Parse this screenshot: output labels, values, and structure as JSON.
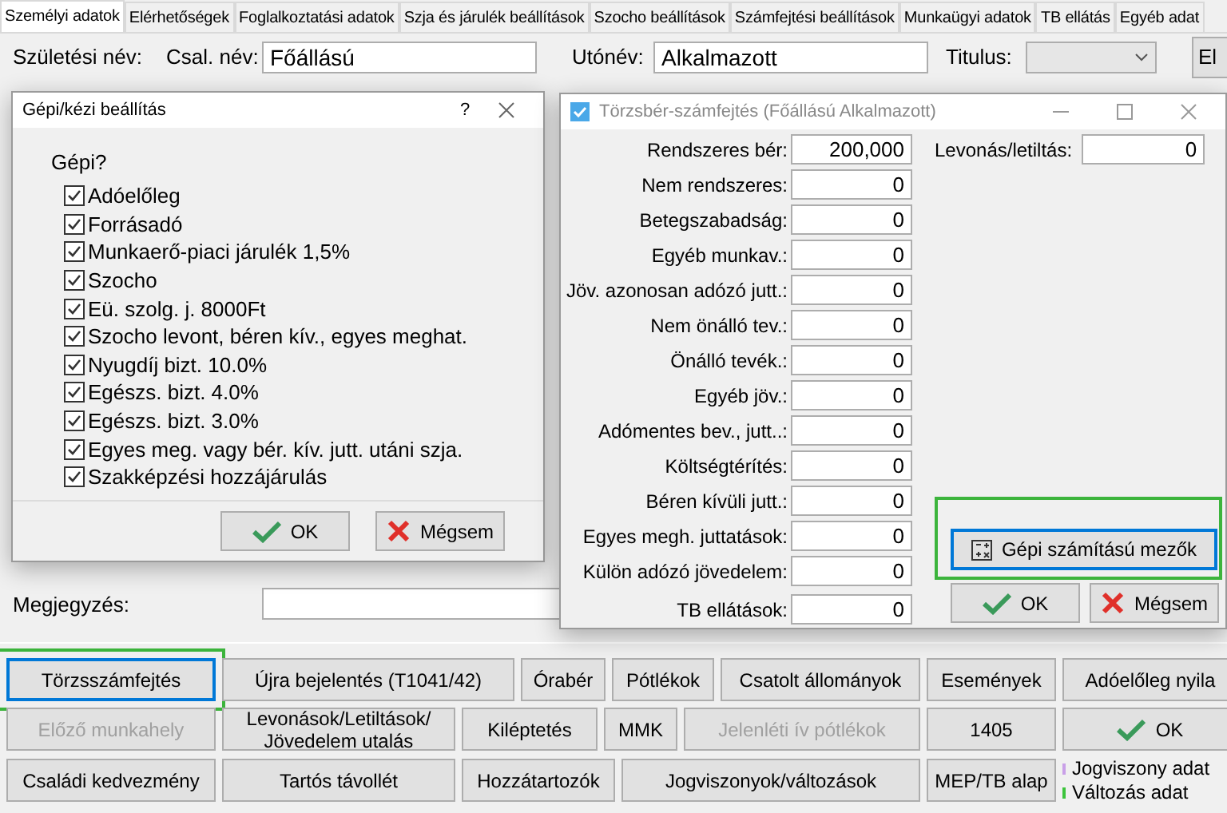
{
  "tabs": [
    {
      "label": "Személyi adatok",
      "selected": true
    },
    {
      "label": "Elérhetőségek",
      "selected": false
    },
    {
      "label": "Foglalkoztatási adatok",
      "selected": false
    },
    {
      "label": "Szja és járulék beállítások",
      "selected": false
    },
    {
      "label": "Szocho beállítások",
      "selected": false
    },
    {
      "label": "Számfejtési beállítások",
      "selected": false
    },
    {
      "label": "Munkaügyi adatok",
      "selected": false
    },
    {
      "label": "TB ellátás",
      "selected": false
    },
    {
      "label": "Egyéb adat",
      "selected": false
    }
  ],
  "form_rows": [
    {
      "label": "Születési név:",
      "family_label": "Csal. név:",
      "family_value": "Főállású",
      "given_label": "Utónév:",
      "given_value": "Alkalmazott",
      "extra_label": "Titulus:",
      "side_button": "El"
    }
  ],
  "note_label": "Megjegyzés:",
  "settings_dialog": {
    "title": "Gépi/kézi beállítás",
    "help": "?",
    "heading": "Gépi?",
    "options": [
      {
        "label": "Adóelőleg",
        "checked": true
      },
      {
        "label": "Forrásadó",
        "checked": true
      },
      {
        "label": "Munkaerő-piaci járulék 1,5%",
        "checked": true
      },
      {
        "label": "Szocho",
        "checked": true
      },
      {
        "label": "Eü. szolg. j. 8000Ft",
        "checked": true
      },
      {
        "label": "Szocho levont, béren kív., egyes meghat.",
        "checked": true
      },
      {
        "label": "Nyugdíj bizt. 10.0%",
        "checked": true
      },
      {
        "label": "Egészs. bizt. 4.0%",
        "checked": true
      },
      {
        "label": "Egészs. bizt. 3.0%",
        "checked": true
      },
      {
        "label": "Egyes meg. vagy bér. kív. jutt. utáni szja.",
        "checked": true
      },
      {
        "label": "Szakképzési hozzájárulás",
        "checked": true
      }
    ],
    "ok": "OK",
    "cancel": "Mégsem"
  },
  "salary_dialog": {
    "title": "Törzsbér-számfejtés (Főállású Alkalmazott)",
    "fields": [
      {
        "label": "Rendszeres bér:",
        "value": "200,000"
      },
      {
        "label": "Nem rendszeres:",
        "value": "0"
      },
      {
        "label": "Betegszabadság:",
        "value": "0"
      },
      {
        "label": "Egyéb munkav.:",
        "value": "0"
      },
      {
        "label": "Jöv. azonosan adózó jutt.:",
        "value": "0"
      },
      {
        "label": "Nem önálló tev.:",
        "value": "0"
      },
      {
        "label": "Önálló tevék.:",
        "value": "0"
      },
      {
        "label": "Egyéb jöv.:",
        "value": "0"
      },
      {
        "label": "Adómentes bev., jutt..:",
        "value": "0"
      },
      {
        "label": "Költségtérítés:",
        "value": "0"
      },
      {
        "label": "Béren kívüli jutt.:",
        "value": "0"
      },
      {
        "label": "Egyes megh. juttatások:",
        "value": "0"
      },
      {
        "label": "Külön adózó jövedelem:",
        "value": "0"
      },
      {
        "label": "TB ellátások:",
        "value": "0"
      }
    ],
    "deduction": {
      "label": "Levonás/letiltás:",
      "value": "0"
    },
    "calc_button": {
      "label": "Gépi számítású mezők",
      "focused": true,
      "highlighted": true
    },
    "ok": "OK",
    "cancel": "Mégsem"
  },
  "bottom_rows": [
    [
      {
        "label": "Törzsszámfejtés",
        "disabled": false,
        "focused": true,
        "highlighted": true
      },
      {
        "label": "Újra bejelentés (T1041/42)",
        "disabled": false,
        "focused": false,
        "highlighted": false
      },
      {
        "label": "Órabér",
        "disabled": false,
        "focused": false,
        "highlighted": false
      },
      {
        "label": "Pótlékok",
        "disabled": false,
        "focused": false,
        "highlighted": false
      },
      {
        "label": "Csatolt állományok",
        "disabled": false,
        "focused": false,
        "highlighted": false
      },
      {
        "label": "Események",
        "disabled": false,
        "focused": false,
        "highlighted": false
      },
      {
        "label": "Adóelőleg nyila",
        "disabled": false,
        "focused": false,
        "highlighted": false
      }
    ],
    [
      {
        "label": "Előző munkahely",
        "disabled": true,
        "focused": false,
        "highlighted": false
      },
      {
        "label": "Levonások/Letiltások/ Jövedelem utalás",
        "disabled": false,
        "focused": false,
        "highlighted": false
      },
      {
        "label": "Kiléptetés",
        "disabled": false,
        "focused": false,
        "highlighted": false
      },
      {
        "label": "MMK",
        "disabled": false,
        "focused": false,
        "highlighted": false
      },
      {
        "label": "Jelenléti ív pótlékok",
        "disabled": true,
        "focused": false,
        "highlighted": false
      },
      {
        "label": "1405",
        "disabled": false,
        "focused": false,
        "highlighted": false
      },
      {
        "label": "OK",
        "kind": "ok",
        "disabled": false,
        "focused": false,
        "highlighted": false
      }
    ],
    [
      {
        "label": "Családi kedvezmény",
        "disabled": false,
        "focused": false,
        "highlighted": false
      },
      {
        "label": "Tartós távollét",
        "disabled": false,
        "focused": false,
        "highlighted": false
      },
      {
        "label": "Hozzátartozók",
        "disabled": false,
        "focused": false,
        "highlighted": false
      },
      {
        "label": "Jogviszonyok/változások",
        "disabled": false,
        "focused": false,
        "highlighted": false
      },
      {
        "label": "MEP/TB alap",
        "disabled": false,
        "focused": false,
        "highlighted": false
      }
    ]
  ],
  "legend": [
    {
      "label": "Jogviszony adat",
      "color": "#c9a0e8"
    },
    {
      "label": "Változás adat",
      "color": "#3cc43c"
    }
  ]
}
